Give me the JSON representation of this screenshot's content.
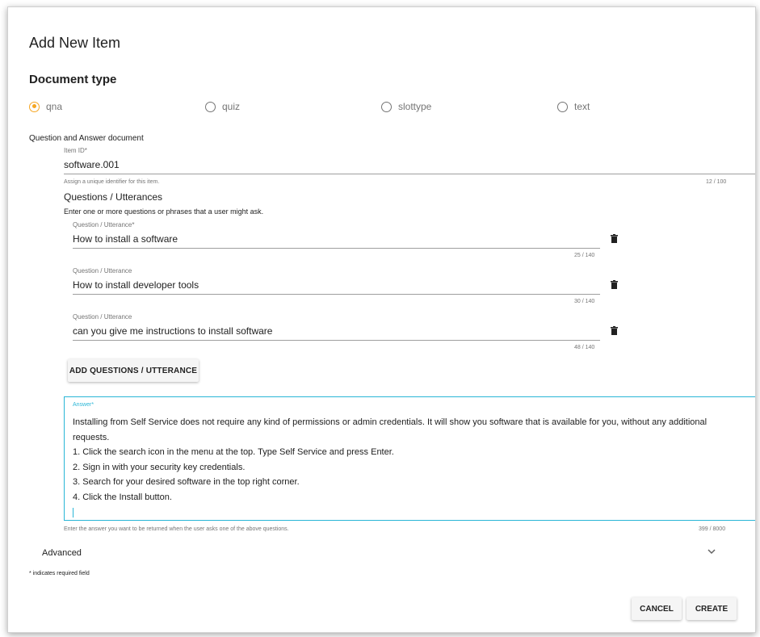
{
  "dialog": {
    "title": "Add New Item",
    "document_type_heading": "Document type"
  },
  "document_types": [
    {
      "label": "qna",
      "selected": true
    },
    {
      "label": "quiz",
      "selected": false
    },
    {
      "label": "slottype",
      "selected": false
    },
    {
      "label": "text",
      "selected": false
    }
  ],
  "document_description": "Question and Answer document",
  "item_id": {
    "label": "Item ID*",
    "value": "software.001",
    "hint": "Assign a unique identifier for this item.",
    "counter": "12 / 100"
  },
  "questions": {
    "heading": "Questions / Utterances",
    "instructions": "Enter one or more questions or phrases that a user might ask.",
    "items": [
      {
        "label": "Question / Utterance*",
        "value": "How to install a software",
        "counter": "25 / 140"
      },
      {
        "label": "Question / Utterance",
        "value": "How to install developer tools",
        "counter": "30 / 140"
      },
      {
        "label": "Question / Utterance",
        "value": "can you give me instructions to install software",
        "counter": "48 / 140"
      }
    ],
    "add_button_label": "ADD QUESTIONS / UTTERANCE"
  },
  "answer": {
    "label": "Answer*",
    "lines": [
      "Installing from Self Service does not require any kind of permissions or admin credentials. It will show you software that is available for you, without any additional",
      "requests.",
      "1. Click the search icon in the menu at the top. Type Self Service and press Enter.",
      "2. Sign in with your security key credentials.",
      "3. Search for your desired software in the top right corner.",
      "4. Click the Install button."
    ],
    "hint": "Enter the answer you want to be returned when the user asks one of the above questions.",
    "counter": "399 / 8000"
  },
  "advanced": {
    "label": "Advanced"
  },
  "required_note": "* indicates required field",
  "footer": {
    "cancel_label": "CANCEL",
    "create_label": "CREATE"
  },
  "colors": {
    "accent_radio": "#f5a623",
    "focus_border": "#29b6d6"
  }
}
